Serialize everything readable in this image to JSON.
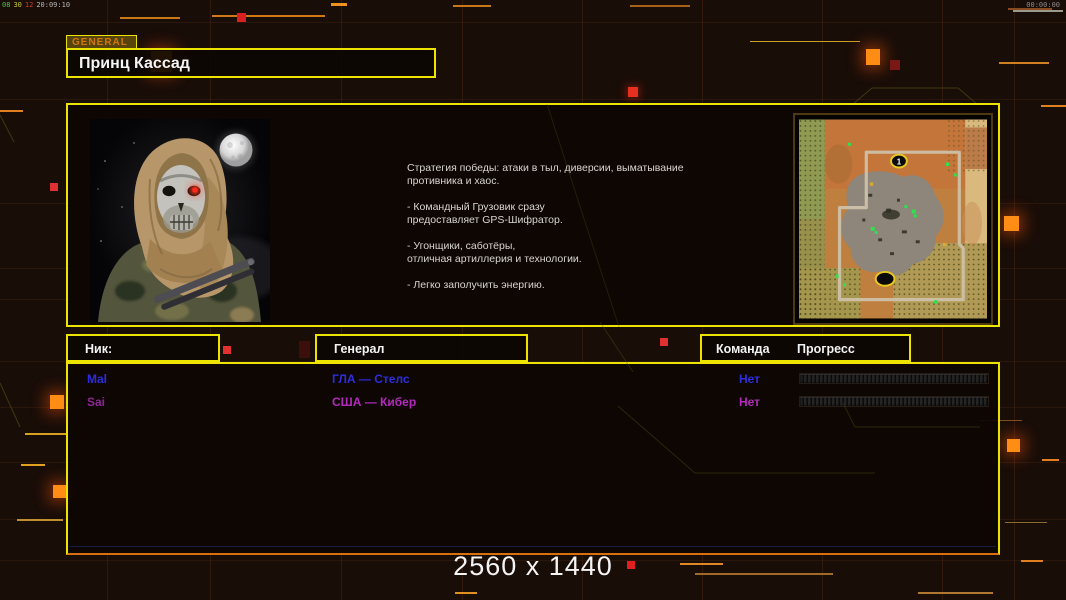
{
  "colors": {
    "border_yellow": "#ece400",
    "accent_orange": "#ff8c14",
    "row_blue": "#2d2de0",
    "row_magenta": "#b32bbd"
  },
  "overlay": {
    "fps_segments": [
      {
        "text": "08",
        "color": "#4cc24c"
      },
      {
        "text": "30",
        "color": "#c8c832"
      },
      {
        "text": "12",
        "color": "#d23c32"
      },
      {
        "text": "20:09:10",
        "color": "#b8b8b8"
      }
    ],
    "clock": "00:00:00"
  },
  "header": {
    "tag": "GENERAL",
    "title": "Принц Кассад"
  },
  "briefing": {
    "paragraphs": [
      "Стратегия победы: атаки в тыл, диверсии, выматывание\n противника и хаос.",
      "- Командный Грузовик сразу\nпредоставляет GPS-Шифратор.",
      "- Угонщики, саботёры,\nотличная артиллерия и технологии.",
      "- Легко заполучить энергию."
    ]
  },
  "minimap": {
    "start_marker": "1"
  },
  "table": {
    "headers": {
      "nick": "Ник:",
      "general": "Генерал",
      "team": "Команда",
      "progress": "Прогресс"
    },
    "rows": [
      {
        "nick": "Mal",
        "general": "ГЛА — Стелс",
        "team": "Нет",
        "color": "#2d2de0",
        "nick_color": "#2d2de0"
      },
      {
        "nick": "Sai",
        "general": "США — Кибер",
        "team": "Нет",
        "color": "#b32bbd",
        "nick_color": "#8d2694"
      }
    ]
  },
  "footer": {
    "resolution": "2560 x 1440"
  }
}
